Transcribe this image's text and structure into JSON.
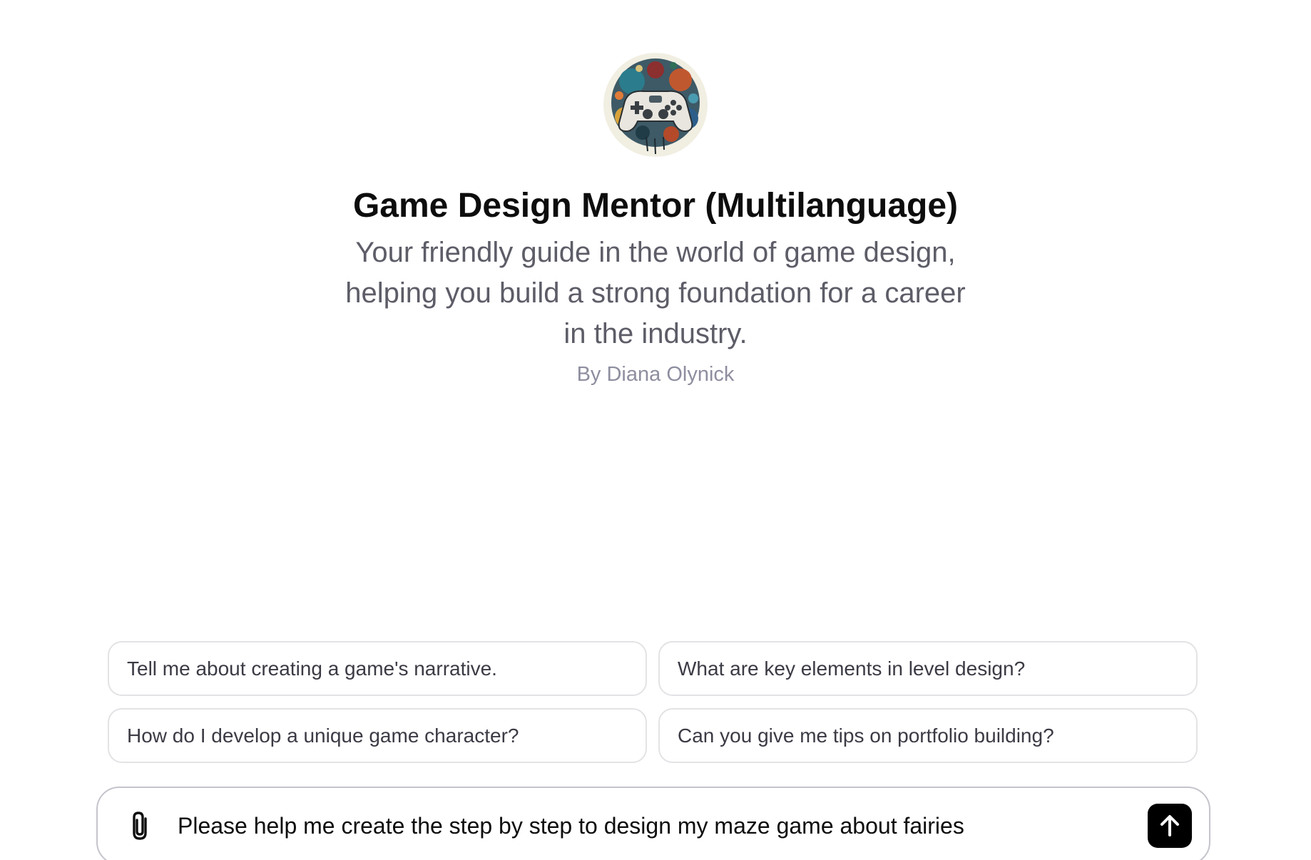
{
  "gpt": {
    "avatar_icon": "gamepad-splash-icon",
    "title": "Game Design Mentor (Multilanguage)",
    "description": "Your friendly guide in the world of game design, helping you build a strong foundation for a career in the industry.",
    "author": "By Diana Olynick"
  },
  "suggestions": [
    {
      "label": "Tell me about creating a game's narrative."
    },
    {
      "label": "What are key elements in level design?"
    },
    {
      "label": "How do I develop a unique game character?"
    },
    {
      "label": "Can you give me tips on portfolio building?"
    }
  ],
  "composer": {
    "value": "Please help me create the step by step to design my maze game about fairies",
    "attach_icon": "paperclip-icon",
    "send_icon": "arrow-up-icon"
  },
  "colors": {
    "title": "#0d0d0d",
    "subtitle": "#5d5d68",
    "byline": "#8e8ea0",
    "send_button": "#000000",
    "card_border": "#e3e3e6"
  }
}
